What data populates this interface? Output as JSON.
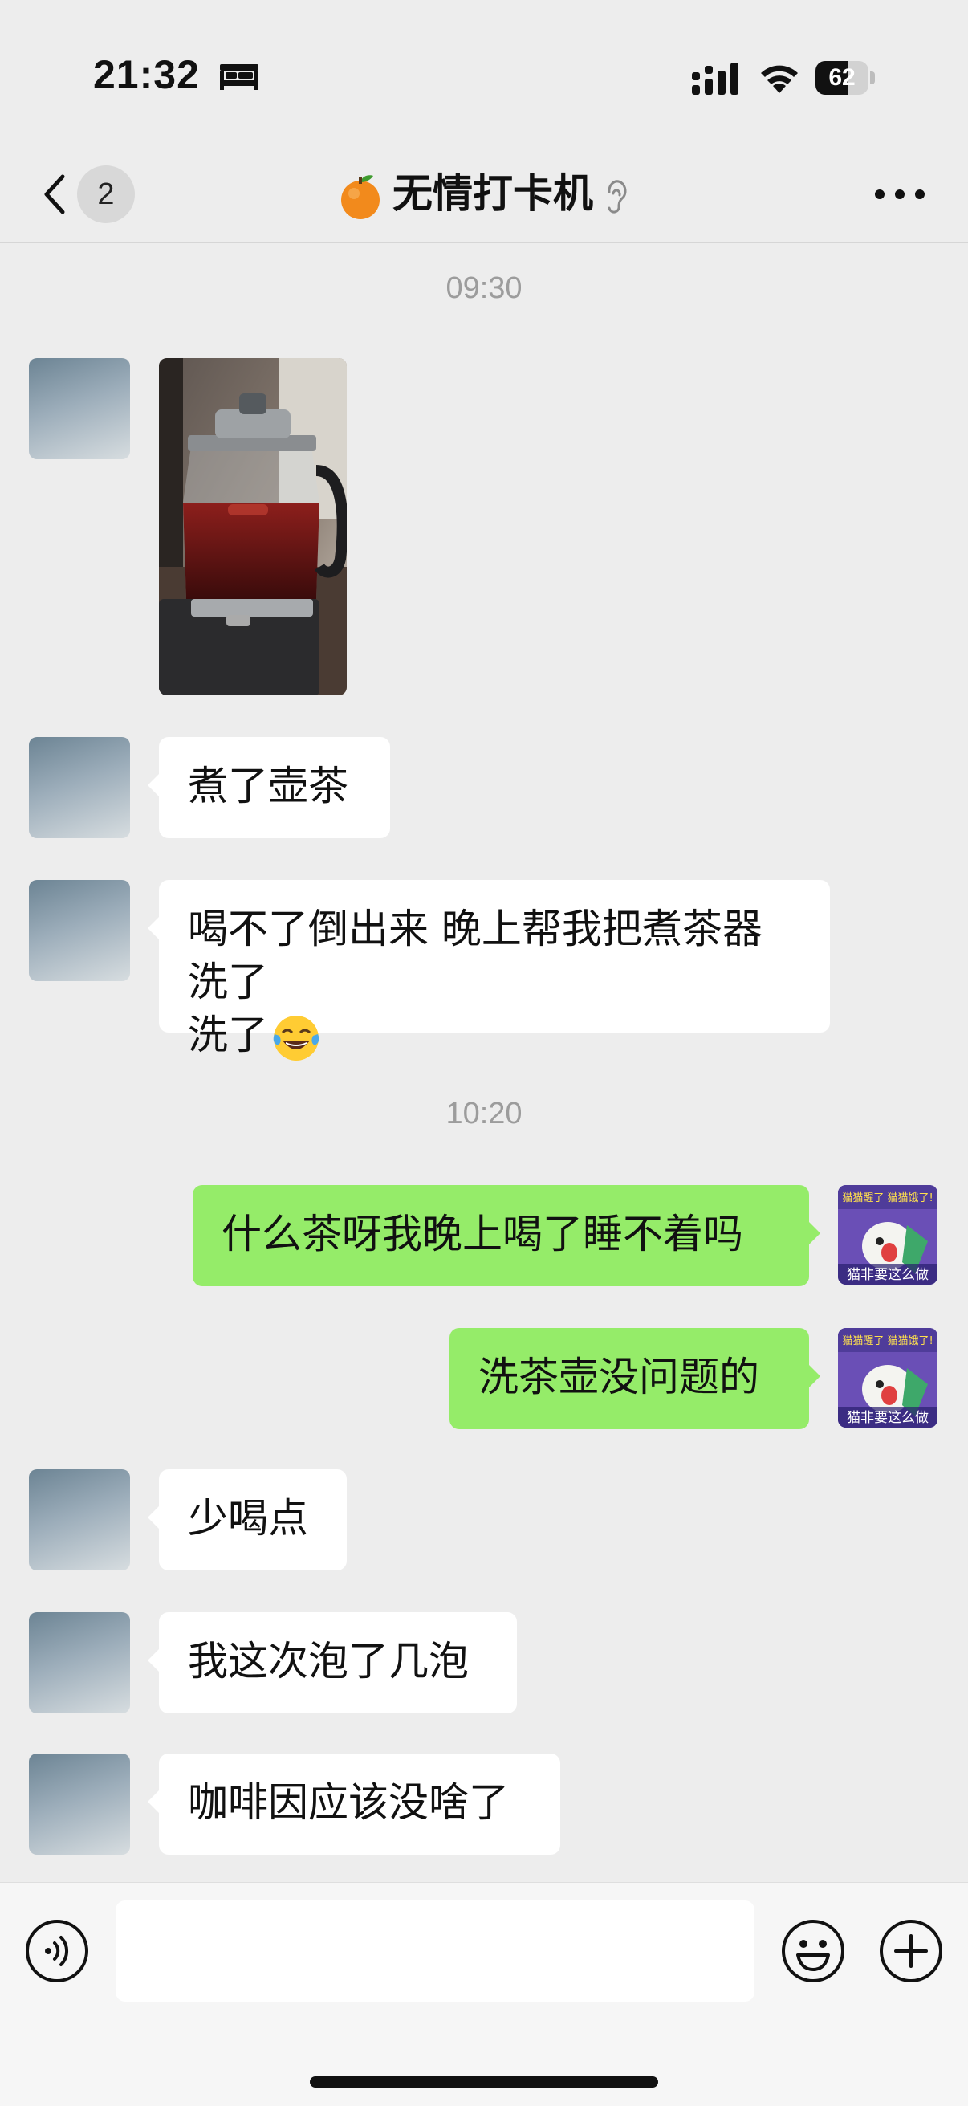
{
  "status_bar": {
    "time": "21:32",
    "battery_percent": "62",
    "battery_level": 0.62,
    "icons": [
      "bed-icon",
      "cellular-signal-icon",
      "wifi-icon",
      "battery-icon"
    ]
  },
  "nav": {
    "unread_count": "2",
    "title": "无情打卡机",
    "icons": [
      "back-chevron-icon",
      "orange-icon",
      "ear-icon",
      "more-dots-icon"
    ]
  },
  "messages": {
    "ts1": "09:30",
    "m_photo": "[teapot photo]",
    "m1": "煮了壶茶",
    "m2": "喝不了倒出来 晚上帮我把煮茶器洗了",
    "m2_emoji": "😂",
    "ts2": "10:20",
    "m3": "什么茶呀我晚上喝了睡不着吗",
    "m4": "洗茶壶没问题的",
    "m5": "少喝点",
    "m6": "我这次泡了几泡",
    "m7": "咖啡因应该没啥了"
  },
  "my_avatar": {
    "top_text": "猫猫醒了 猫猫饿了!",
    "bottom_text": "猫非要这么做"
  },
  "input_bar": {
    "value": "",
    "icons": [
      "voice-icon",
      "emoji-icon",
      "plus-icon"
    ]
  },
  "colors": {
    "background": "#ededed",
    "outgoing_bubble": "#95ec69",
    "incoming_bubble": "#ffffff",
    "timestamp": "#9c9c9c"
  }
}
